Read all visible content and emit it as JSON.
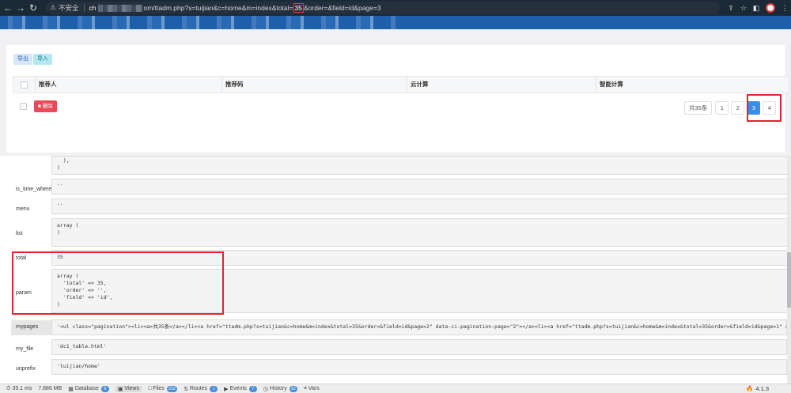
{
  "browser": {
    "insecure_label": "不安全",
    "host_prefix": "ch",
    "url_part1": "om/ttadm.php?s=tuijian&c=home&m=index&total=",
    "url_highlight": "35",
    "url_part2": "&order=&field=id&page=3"
  },
  "toolbar": {
    "export_label": "导出",
    "import_label": "导入",
    "delete_label": "删除"
  },
  "table": {
    "columns": [
      "推荐人",
      "推荐码",
      "云计算",
      "智能计算"
    ]
  },
  "pagination": {
    "total_label": "共35条",
    "pages": [
      "1",
      "2",
      "3",
      "4"
    ],
    "active_page": "3"
  },
  "debug": {
    "top_fragment": "  ),\n)",
    "rows": [
      {
        "key": "is_time_where",
        "value": "''"
      },
      {
        "key": "menu",
        "value": "''"
      },
      {
        "key": "list",
        "value": "array (\n)"
      },
      {
        "key": "total",
        "value": "35"
      },
      {
        "key": "param",
        "value": "array (\n  'total' => 35,\n  'order' => '',\n  'field' => 'id',\n)"
      },
      {
        "key": "mypages",
        "value": "'<ul class=\"pagination\"><li><a>共35条</a></li><a href=\"ttadm.php?s=tuijian&c=home&m=index&total=35&order=&field=id&page=2\" data-ci-pagination-page=\"2\"></a><li><a href=\"ttadm.php?s=tuijian&c=home&m=index&total=35&order=&field=id&page=1\" data-ci-pagi"
      },
      {
        "key": "my_file",
        "value": "'dc1_table.html'"
      },
      {
        "key": "uriprefix",
        "value": "'tuijian/home'"
      }
    ]
  },
  "debug_toolbar": {
    "time": "35.1 ms",
    "memory": "7.886 MB",
    "items": [
      {
        "label": "Database",
        "badge": "6"
      },
      {
        "label": "Views",
        "badge": ""
      },
      {
        "label": "Files",
        "badge": "232"
      },
      {
        "label": "Routes",
        "badge": "1"
      },
      {
        "label": "Events",
        "badge": "7"
      },
      {
        "label": "History",
        "badge": "32"
      },
      {
        "label": "Vars",
        "badge": ""
      }
    ],
    "version": "4.1.3"
  },
  "colors": {
    "header_blue": "#1d5fab",
    "active_page": "#3a8ee6",
    "danger": "#e84a5a",
    "highlight_red": "#e0262e"
  }
}
